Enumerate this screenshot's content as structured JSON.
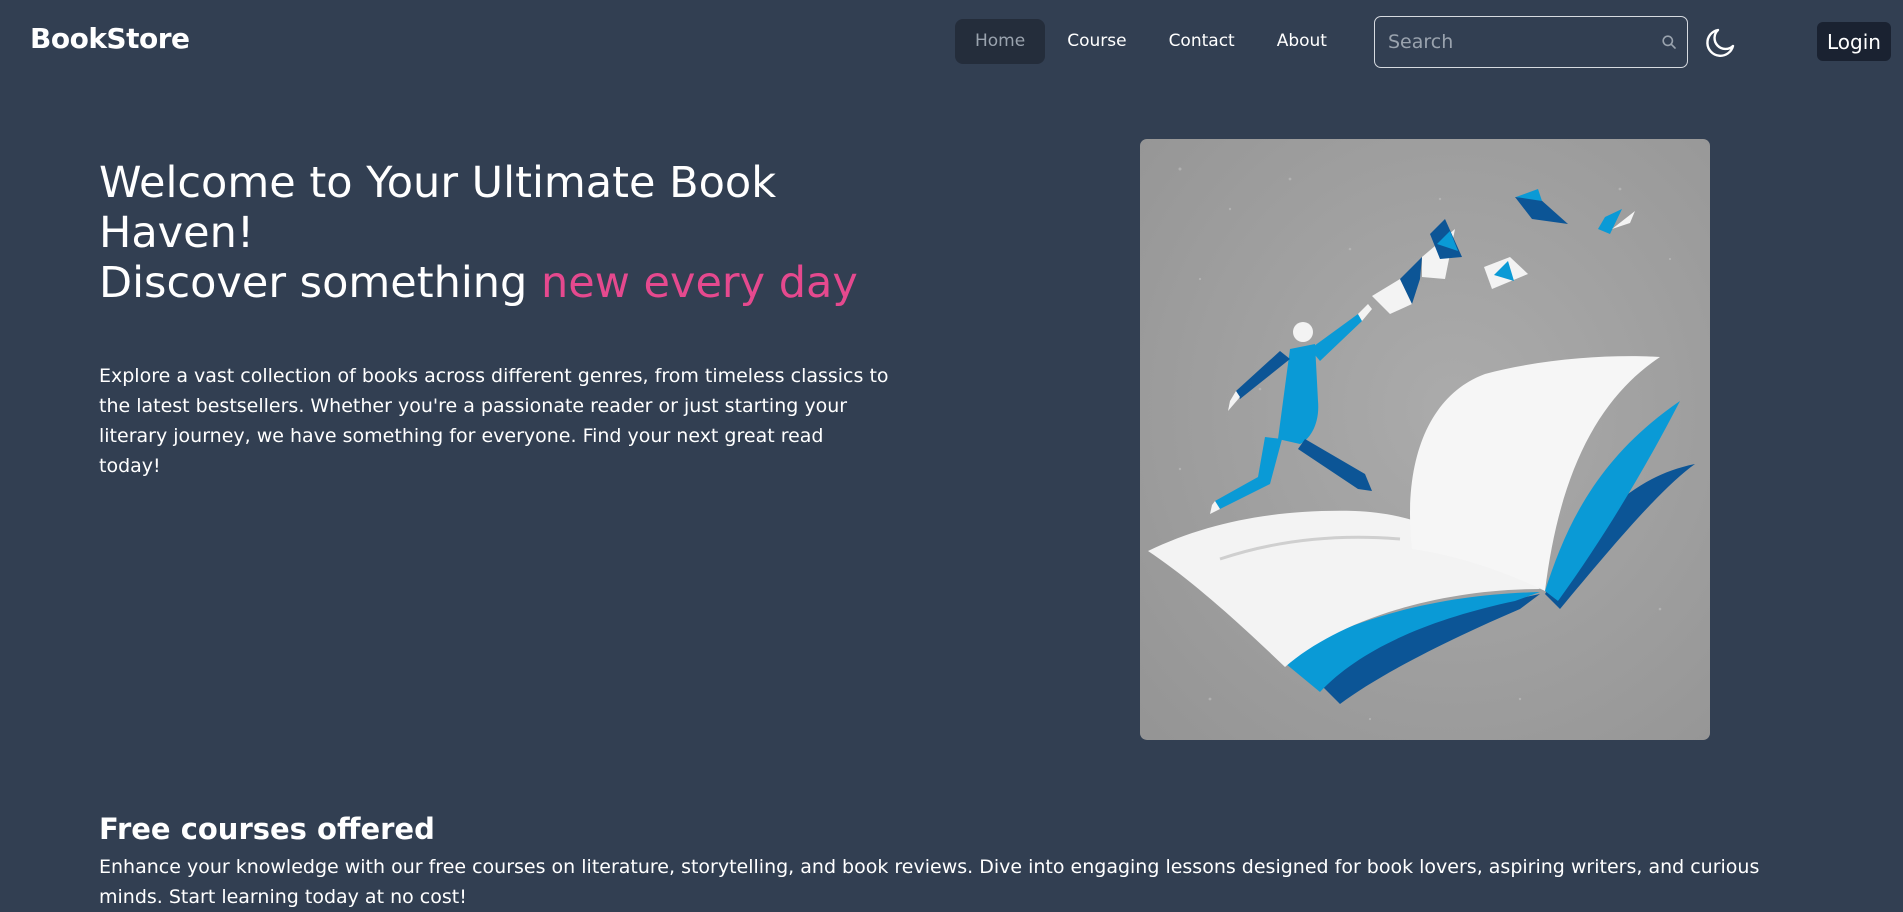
{
  "navbar": {
    "brand": "BookStore",
    "links": [
      {
        "label": "Home",
        "active": true
      },
      {
        "label": "Course",
        "active": false
      },
      {
        "label": "Contact",
        "active": false
      },
      {
        "label": "About",
        "active": false
      }
    ],
    "search": {
      "placeholder": "Search",
      "value": "",
      "icon": "search-icon"
    },
    "theme_icon": "moon-icon",
    "login_label": "Login"
  },
  "hero": {
    "title_line1": "Welcome to Your Ultimate Book Haven!",
    "title_line2_prefix": "Discover something ",
    "title_line2_highlight": "new every day",
    "description": "Explore a vast collection of books across different genres, from timeless classics to the latest bestsellers. Whether you're a passionate reader or just starting your literary journey, we have something for everyone. Find your next great read today!"
  },
  "courses": {
    "heading": "Free courses offered",
    "description": "Enhance your knowledge with our free courses on literature, storytelling, and book reviews. Dive into engaging lessons designed for book lovers, aspiring writers, and curious minds. Start learning today at no cost!"
  },
  "colors": {
    "background": "#323f52",
    "accent_pink": "#e5498e",
    "nav_active_bg": "#242d3b",
    "login_bg": "#1a2231",
    "illustration_bg": "#9c9c9c",
    "illustration_blue": "#0a9ad6",
    "illustration_dark_blue": "#0c5596"
  }
}
